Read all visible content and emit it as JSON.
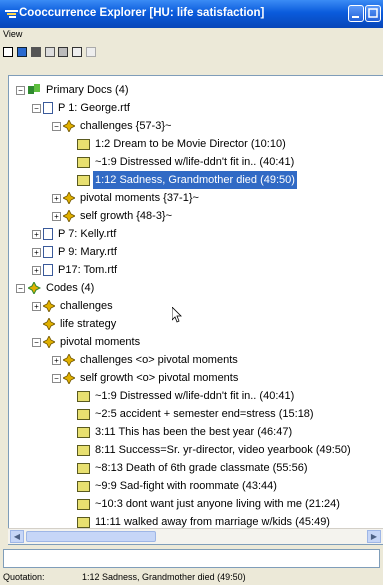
{
  "window": {
    "title": "Cooccurrence Explorer [HU: life satisfaction]"
  },
  "menu": {
    "view": "View"
  },
  "toolbar": {
    "icons": [
      "new-icon",
      "open-icon",
      "save-icon",
      "tree-icon",
      "copy-icon",
      "export-icon",
      "print-icon"
    ]
  },
  "tree": {
    "primary_docs": "Primary Docs (4)",
    "p1": "P 1: George.rtf",
    "p1_challenges": "challenges {57-3}~",
    "q1": "1:2 Dream to be Movie Director (10:10)",
    "q2": "~1:9 Distressed w/life-ddn't fit in.. (40:41)",
    "q3": "1:12 Sadness, Grandmother died (49:50)",
    "p1_pivotal": "pivotal moments {37-1}~",
    "p1_selfgrowth": "self growth {48-3}~",
    "p7": "P 7: Kelly.rtf",
    "p9": "P 9: Mary.rtf",
    "p17": "P17: Tom.rtf",
    "codes": "Codes (4)",
    "c_challenges": "challenges",
    "c_lifestrategy": "life strategy",
    "c_pivotal": "pivotal moments",
    "c_chal_pivot": "challenges <o> pivotal moments",
    "c_self_pivot": "self growth <o> pivotal moments",
    "s1": "~1:9 Distressed w/life-ddn't fit in.. (40:41)",
    "s2": "~2:5 accident + semester end=stress (15:18)",
    "s3": "3:11 This has been the best year (46:47)",
    "s4": "8:11 Success=Sr. yr-director, video yearbook (49:50)",
    "s5": "~8:13 Death of 6th grade classmate (55:56)",
    "s6": "~9:9 Sad-fight with roommate (43:44)",
    "s7": "~10:3 dont want just anyone living with me (21:24)",
    "s8": "11:11 walked away from marriage w/kids (45:49)"
  },
  "status": {
    "label": "Quotation:",
    "value": "1:12 Sadness, Grandmother died (49:50)"
  },
  "colors": {
    "selection": "#316ac5",
    "titlebar": "#0a5bdc",
    "code_icon": "#e0b000",
    "family_icon": "#2f8a2f"
  }
}
